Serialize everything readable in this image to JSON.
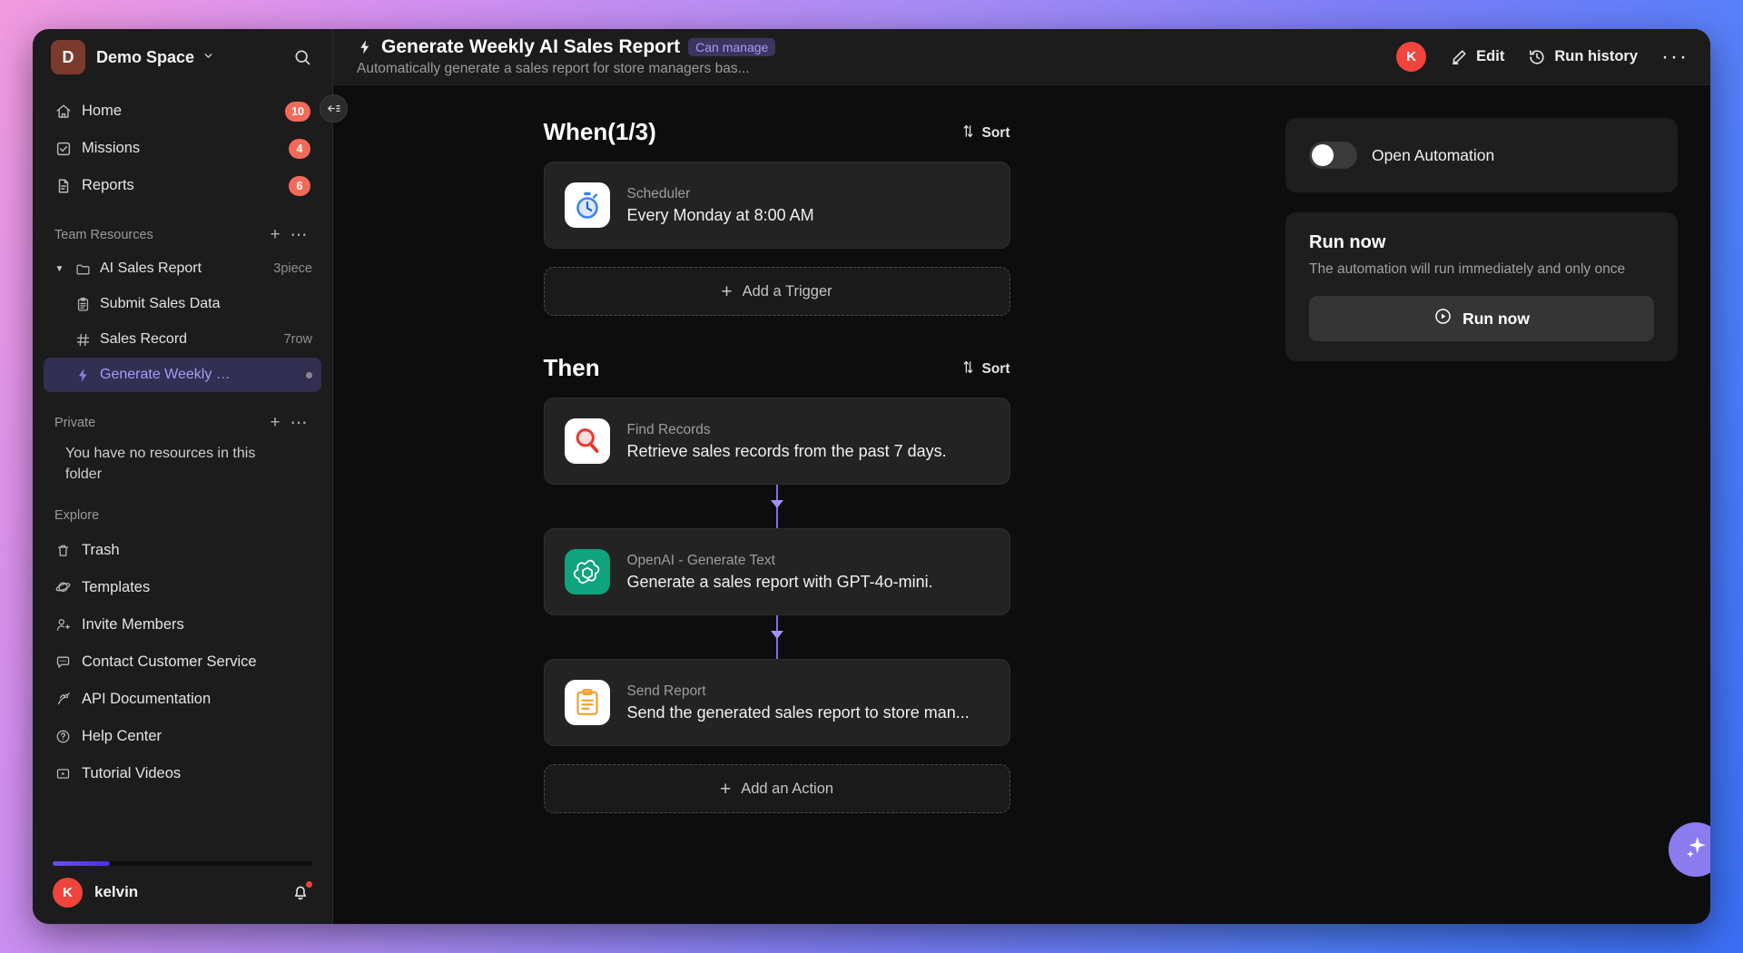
{
  "workspace": {
    "avatar_letter": "D",
    "name": "Demo Space",
    "search_icon": "search-icon"
  },
  "sidebar": {
    "nav": [
      {
        "icon": "home-icon",
        "label": "Home",
        "badge": "10"
      },
      {
        "icon": "checkbox-icon",
        "label": "Missions",
        "badge": "4"
      },
      {
        "icon": "document-icon",
        "label": "Reports",
        "badge": "6"
      }
    ],
    "team_resources": {
      "title": "Team Resources",
      "add_label": "+",
      "more_label": "⋯",
      "folder": {
        "icon": "folder-icon",
        "name": "AI Sales Report",
        "meta": "3piece",
        "caret": "▼"
      },
      "children": [
        {
          "icon": "clipboard-icon",
          "name": "Submit Sales Data",
          "meta": "",
          "selected": false
        },
        {
          "icon": "grid-icon",
          "name": "Sales Record",
          "meta": "7row",
          "selected": false
        },
        {
          "icon": "bolt-icon",
          "name": "Generate Weekly …",
          "meta": "",
          "selected": true
        }
      ]
    },
    "private": {
      "title": "Private",
      "add_label": "+",
      "more_label": "⋯",
      "empty_text": "You have no resources in this folder"
    },
    "explore": {
      "title": "Explore",
      "items": [
        {
          "icon": "trash-icon",
          "label": "Trash"
        },
        {
          "icon": "planet-icon",
          "label": "Templates"
        },
        {
          "icon": "user-plus-icon",
          "label": "Invite Members"
        },
        {
          "icon": "chat-icon",
          "label": "Contact Customer Service"
        },
        {
          "icon": "api-icon",
          "label": "API Documentation"
        },
        {
          "icon": "help-icon",
          "label": "Help Center"
        },
        {
          "icon": "video-icon",
          "label": "Tutorial Videos"
        }
      ]
    },
    "footer": {
      "avatar_letter": "K",
      "username": "kelvin",
      "bell_icon": "bell-icon"
    },
    "collapse_icon": "collapse-sidebar-icon"
  },
  "header": {
    "bolt_icon": "bolt-icon",
    "title": "Generate Weekly AI Sales Report",
    "permission_badge": "Can manage",
    "subtitle": "Automatically generate a sales report for store managers bas...",
    "avatar_letter": "K",
    "edit_label": "Edit",
    "run_history_label": "Run history",
    "more_label": "···"
  },
  "flow": {
    "when": {
      "title": "When(1/3)",
      "sort_label": "Sort",
      "nodes": [
        {
          "icon": "stopwatch-icon",
          "kind": "Scheduler",
          "description": "Every Monday at 8:00 AM"
        }
      ],
      "add_label": "Add a Trigger"
    },
    "then": {
      "title": "Then",
      "sort_label": "Sort",
      "nodes": [
        {
          "icon": "magnifier-icon",
          "kind": "Find Records",
          "description": "Retrieve sales records from the past 7 days."
        },
        {
          "icon": "openai-icon",
          "kind": "OpenAI - Generate Text",
          "description": "Generate a sales report with GPT-4o-mini."
        },
        {
          "icon": "clipboard-report-icon",
          "kind": "Send Report",
          "description": "Send the generated sales report to store man..."
        }
      ],
      "add_label": "Add an Action"
    }
  },
  "right_panel": {
    "automation_toggle": {
      "label": "Open Automation",
      "state": "off"
    },
    "run_now": {
      "title": "Run now",
      "subtitle": "The automation will run immediately and only once",
      "button_label": "Run now",
      "button_icon": "play-circle-icon"
    }
  },
  "fab": {
    "icon": "ai-sparkle-icon"
  },
  "colors": {
    "accent_purple": "#8b7cf0",
    "badge_red": "#f26a5a",
    "avatar_red": "#f0443c",
    "openai_green": "#10a37f",
    "window_bg": "#191919",
    "sidebar_bg": "#1c1c1c",
    "canvas_bg": "#0d0d0d"
  }
}
